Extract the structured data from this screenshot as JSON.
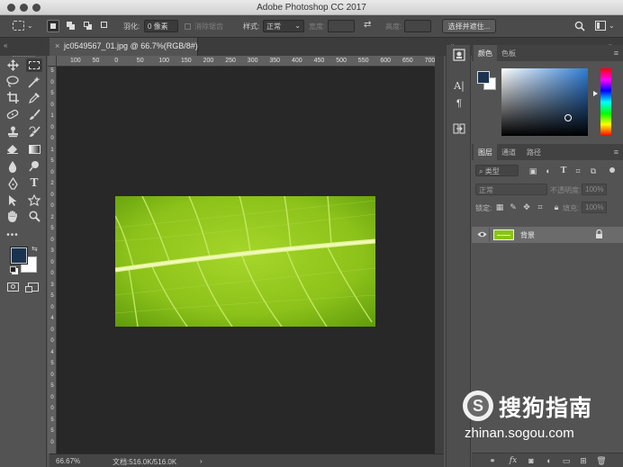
{
  "app": {
    "title": "Adobe Photoshop CC 2017"
  },
  "options": {
    "feather_label": "羽化:",
    "feather_value": "0 像素",
    "antialias_label": "消除锯齿",
    "style_label": "样式:",
    "style_value": "正常",
    "width_label": "宽度:",
    "height_label": "高度:",
    "select_mask_button": "选择并遮住..."
  },
  "document": {
    "tab_label": "jc0549567_01.jpg @ 66.7%(RGB/8#)",
    "close_glyph": "×"
  },
  "ruler": {
    "h_ticks": [
      "100",
      "50",
      "0",
      "50",
      "100",
      "150",
      "200",
      "250",
      "300",
      "350",
      "400",
      "450",
      "500",
      "550",
      "600",
      "650",
      "700"
    ],
    "v_ticks": [
      "5",
      "0",
      "5",
      "0",
      "1",
      "0",
      "0",
      "1",
      "5",
      "0",
      "2",
      "0",
      "0",
      "2",
      "5",
      "0",
      "3",
      "0",
      "0",
      "3",
      "5",
      "0",
      "4",
      "0",
      "0",
      "4",
      "5",
      "0",
      "5",
      "0",
      "0",
      "5",
      "5",
      "0"
    ]
  },
  "status": {
    "zoom": "66.67%",
    "doc_info": "文档:516.0K/516.0K",
    "arrow": "›"
  },
  "color_panel": {
    "tabs": [
      "颜色",
      "色板"
    ],
    "foreground": "#1b3350",
    "background": "#ffffff"
  },
  "layers_panel": {
    "tabs": [
      "图层",
      "通道",
      "路径"
    ],
    "filter_label": "类型",
    "blend_mode": "正常",
    "opacity_label": "不透明度:",
    "opacity_value": "100%",
    "lock_label": "锁定:",
    "fill_label": "填充:",
    "fill_value": "100%",
    "layers": [
      {
        "name": "背景",
        "locked": true,
        "visible": true
      }
    ]
  },
  "watermark": {
    "brand": "搜狗指南",
    "url": "zhinan.sogou.com"
  },
  "colors": {
    "leaf": "#8cc21a",
    "accent": "#2f7dd6"
  }
}
